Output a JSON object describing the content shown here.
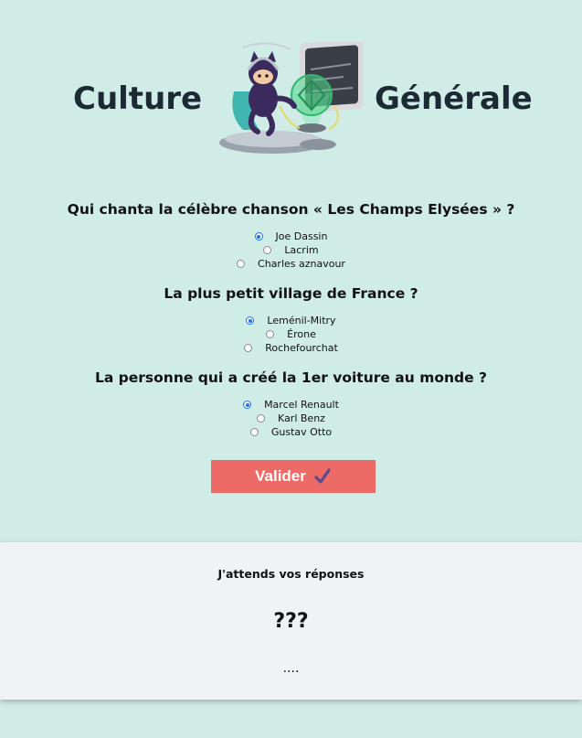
{
  "header": {
    "title_left": "Culture",
    "title_right": "Générale",
    "mascot_icon": "octocat-scientist-icon"
  },
  "questions": [
    {
      "text": "Qui chanta la célèbre chanson « Les Champs Elysées » ?",
      "options": [
        "Joe Dassin",
        "Lacrim",
        "Charles aznavour"
      ],
      "selected": 0
    },
    {
      "text": "La plus petit village de France ?",
      "options": [
        "Leménil-Mitry",
        "Érone",
        "Rochefourchat"
      ],
      "selected": 0
    },
    {
      "text": "La personne qui a créé la 1er voiture au monde ?",
      "options": [
        "Marcel Renault",
        "Karl Benz",
        "Gustav Otto"
      ],
      "selected": 0
    }
  ],
  "submit": {
    "label": "Valider",
    "icon": "checkmark-icon",
    "color": "#ec6b67"
  },
  "result": {
    "title": "J'attends vos réponses",
    "score": "???",
    "detail": "...."
  },
  "colors": {
    "background": "#d0ece7",
    "panel": "#f1f2f4",
    "radio_accent": "#1a73e8"
  }
}
